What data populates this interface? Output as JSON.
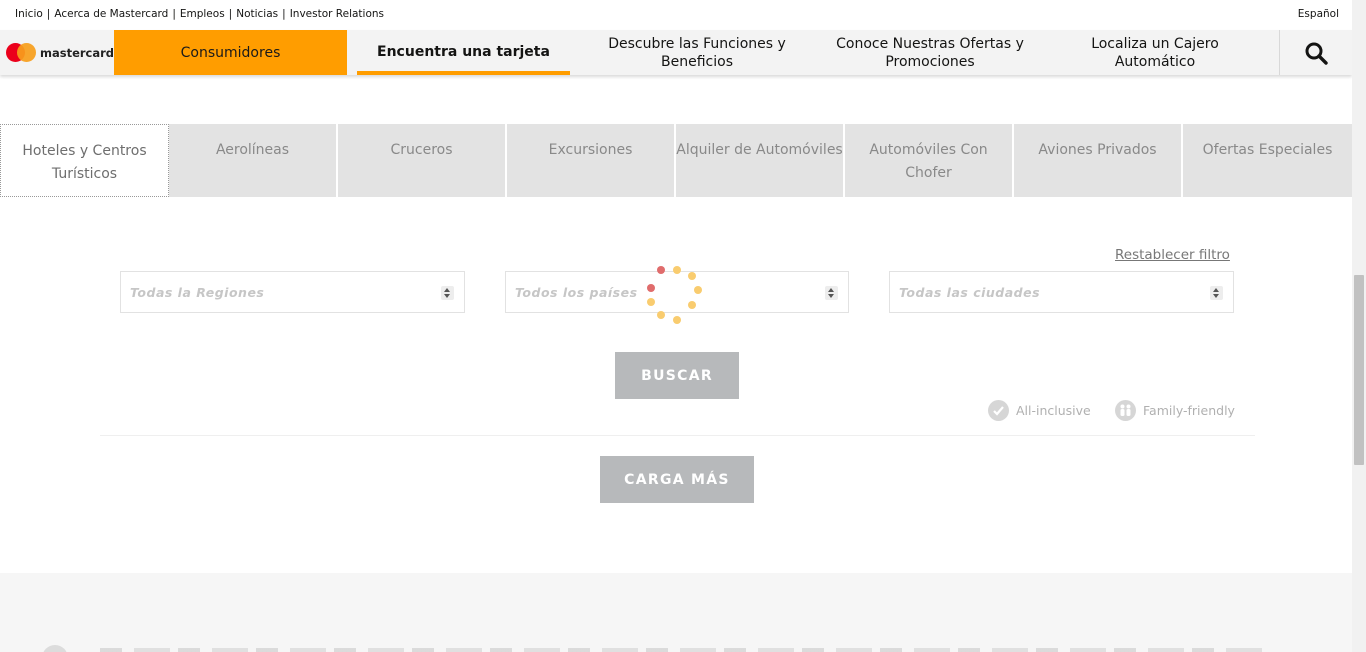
{
  "utility": {
    "links": [
      "Inicio",
      "Acerca de Mastercard",
      "Empleos",
      "Noticias",
      "Investor Relations"
    ],
    "language": "Español"
  },
  "nav": {
    "logo_text": "mastercard",
    "consumers": "Consumidores",
    "items": [
      "Encuentra una tarjeta",
      "Descubre las Funciones y Beneficios",
      "Conoce Nuestras Ofertas y Promociones",
      "Localiza un Cajero Automático"
    ],
    "active_item": "Encuentra una tarjeta",
    "search_icon": "search-icon"
  },
  "tabs": [
    "Hoteles y Centros Turísticos",
    "Aerolíneas",
    "Cruceros",
    "Excursiones",
    "Alquiler de Automóviles",
    "Automóviles Con Chofer",
    "Aviones Privados",
    "Ofertas Especiales"
  ],
  "active_tab": "Hoteles y Centros Turísticos",
  "filters": {
    "reset": "Restablecer filtro",
    "region_placeholder": "Todas la Regiones",
    "country_placeholder": "Todos los países",
    "city_placeholder": "Todas las ciudades"
  },
  "search_button": "BUSCAR",
  "legend": {
    "all_inclusive": "All-inclusive",
    "family_friendly": "Family-friendly"
  },
  "load_more": "CARGA MÁS",
  "colors": {
    "brand_orange": "#ff9d00",
    "mc_red": "#eb001b",
    "mc_yellow": "#f79e1b",
    "button_gray": "#b7b9bb",
    "spinner_yellow": "#f9cc6f",
    "spinner_red": "#e06c6c"
  }
}
